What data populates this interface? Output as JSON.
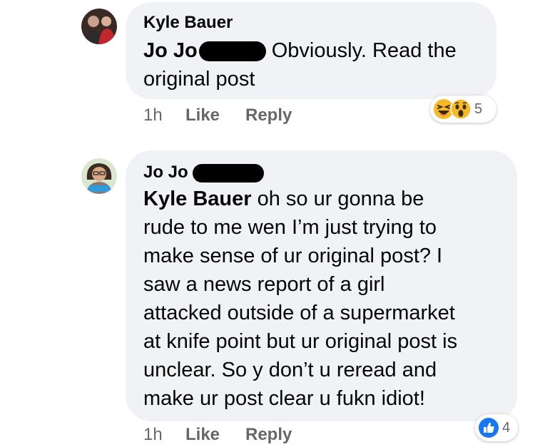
{
  "comments": [
    {
      "author": "Kyle Bauer",
      "mention": "Jo Jo",
      "body": "Obviously. Read the",
      "body_line2": "original post",
      "time": "1h",
      "like_label": "Like",
      "reply_label": "Reply",
      "reaction_count": "5",
      "reaction_icons": [
        "laugh-emoji",
        "wow-emoji"
      ]
    },
    {
      "author": "Jo Jo",
      "mention": "Kyle Bauer",
      "body_line1": "oh so ur gonna be",
      "body_lines": [
        "rude to me wen I’m just trying to",
        "make sense of ur original post? I",
        "saw a news report of a girl",
        "attacked outside of a supermarket",
        "at knife point but ur original post is",
        "unclear. So y don’t u reread and",
        "make ur post clear u fukn idiot!"
      ],
      "time": "1h",
      "like_label": "Like",
      "reply_label": "Reply",
      "reaction_count": "4",
      "reaction_icons": [
        "like-thumb"
      ]
    }
  ],
  "colors": {
    "bubble": "#f0f2f5",
    "meta": "#65676b",
    "like_blue": "#1877f2",
    "redaction": "#000000"
  }
}
